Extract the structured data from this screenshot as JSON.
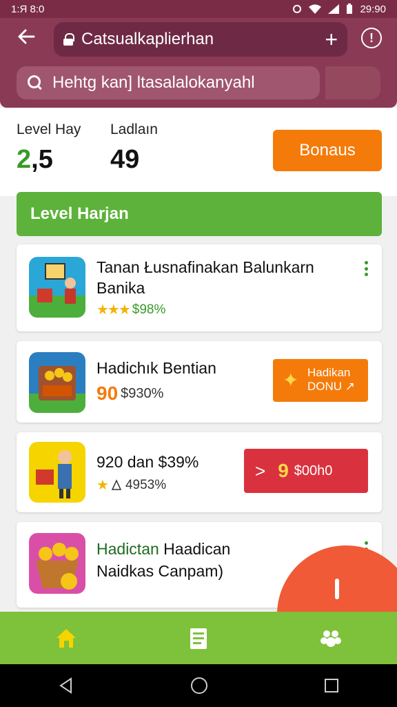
{
  "status_bar": {
    "time": "1:Я 8:0",
    "clock_right": "29:90"
  },
  "browser": {
    "url": "Catsualkaplierhan",
    "search_placeholder": "Hehtg kan] ltasalalokanyahl"
  },
  "stats": {
    "level_label": "Level Hay",
    "level_value_main": "2",
    "level_value_rest": ",5",
    "ladder_label": "Ladlaın",
    "ladder_value": "49",
    "bonus_button": "Bonaus"
  },
  "section": {
    "title": "Level Harjan"
  },
  "cards": [
    {
      "title": "Tanan Łusnafinakan Balunkarn Banika",
      "rating": "$98%"
    },
    {
      "title": "Hadichık Bentian",
      "badge": "90",
      "meta": "$930%",
      "button": "Hadikan DONU ↗"
    },
    {
      "title": "920 dan $39%",
      "meta": "4953%",
      "button_badge": "9",
      "button_text": "$00h0"
    },
    {
      "title_bold": "Hadictan",
      "title_rest": " Haadican",
      "subtitle": "Naidkas Canpam)"
    }
  ],
  "colors": {
    "header": "#8a3a55",
    "accent_green": "#5cb23a",
    "accent_orange": "#f47b0a",
    "accent_red": "#d9323e",
    "fab": "#f05a36"
  },
  "icons": [
    "back-arrow-icon",
    "lock-icon",
    "plus-icon",
    "info-icon",
    "search-icon",
    "home-icon",
    "list-icon",
    "paw-icon"
  ]
}
